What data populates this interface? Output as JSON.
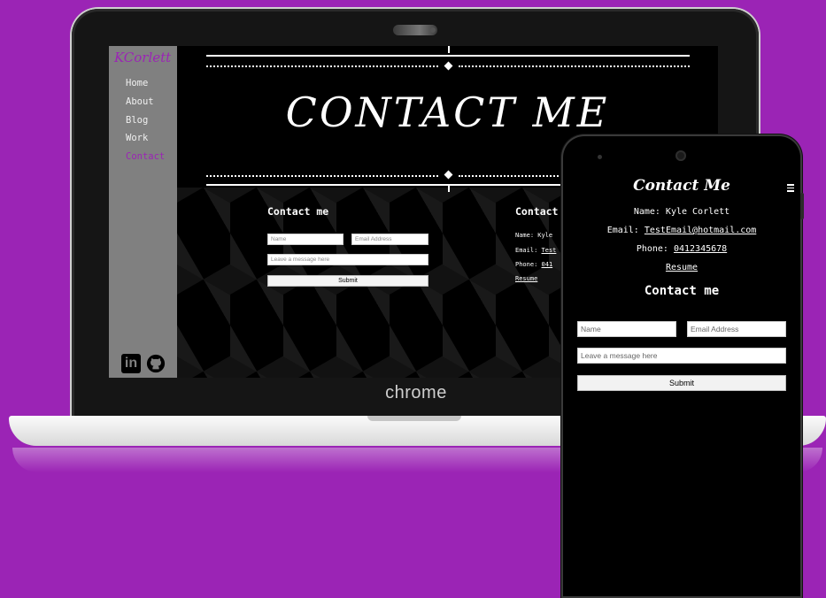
{
  "laptop": {
    "browser_brand": "chrome",
    "sidebar": {
      "brand": "KCorlett",
      "nav": [
        {
          "label": "Home",
          "active": false
        },
        {
          "label": "About",
          "active": false
        },
        {
          "label": "Blog",
          "active": false
        },
        {
          "label": "Work",
          "active": false
        },
        {
          "label": "Contact",
          "active": true
        }
      ],
      "social_icons": [
        "linkedin-icon",
        "github-icon"
      ],
      "linkedin_label": "in"
    },
    "hero": {
      "title": "CONTACT ME"
    },
    "form": {
      "title": "Contact me",
      "name_placeholder": "Name",
      "email_placeholder": "Email Address",
      "message_placeholder": "Leave a message here",
      "submit_label": "Submit"
    },
    "info": {
      "title": "Contact",
      "name_line": "Name: Kyle",
      "email_prefix": "Email: ",
      "email_value": "Test",
      "phone_prefix": "Phone: ",
      "phone_value": "041",
      "resume": "Resume"
    }
  },
  "phone": {
    "brand": "Contact Me",
    "name_line": "Name: Kyle Corlett",
    "email_prefix": "Email: ",
    "email_value": "TestEmail@hotmail.com",
    "phone_prefix": "Phone: ",
    "phone_value": "0412345678",
    "resume": "Resume",
    "form": {
      "title": "Contact me",
      "name_placeholder": "Name",
      "email_placeholder": "Email Address",
      "message_placeholder": "Leave a message here",
      "submit_label": "Submit"
    }
  },
  "colors": {
    "background": "#9b24b5",
    "accent": "#9b24b5",
    "sidebar": "#808080"
  }
}
